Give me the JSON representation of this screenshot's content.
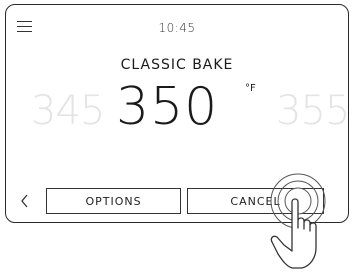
{
  "header": {
    "time": "10:45"
  },
  "cooking": {
    "mode_title": "CLASSIC BAKE",
    "temperature_prev": "345",
    "temperature_current": "350",
    "temperature_unit": "°F",
    "temperature_next": "355"
  },
  "footer": {
    "back_icon": "chevron-left",
    "options_label": "OPTIONS",
    "cancel_label": "CANCEL"
  },
  "icons": {
    "menu": "hamburger-menu",
    "touch": "hand-pointer-tap"
  }
}
